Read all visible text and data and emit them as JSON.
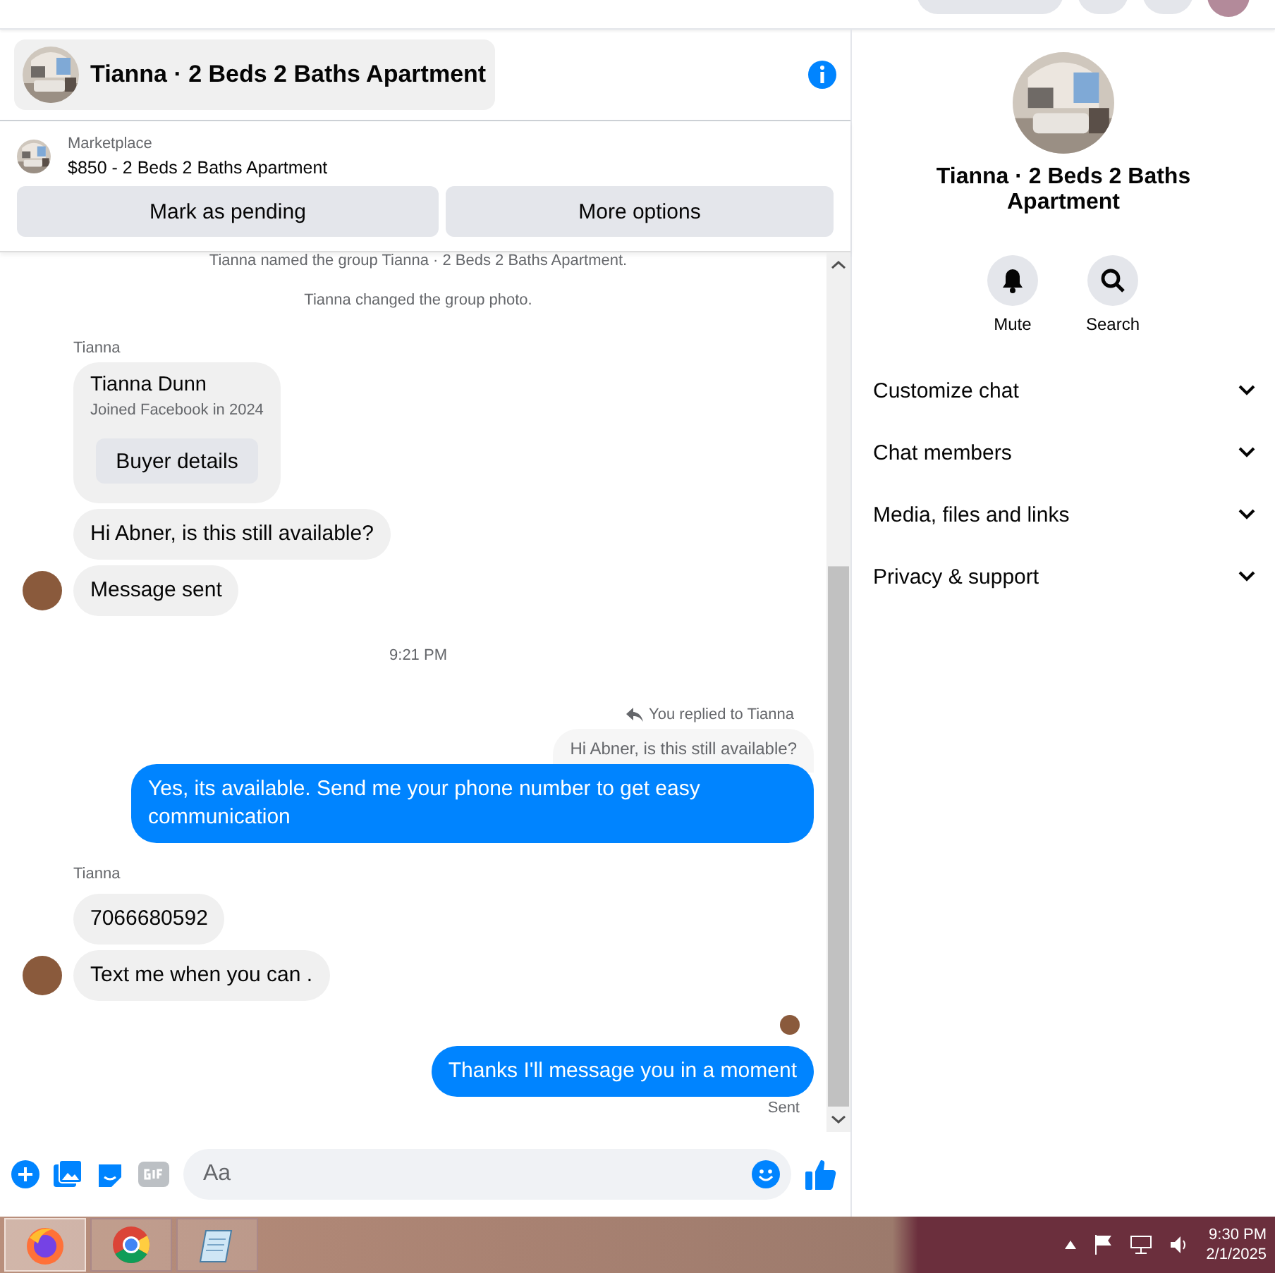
{
  "conversation_header": {
    "title": "Tianna · 2 Beds 2 Baths Apartment"
  },
  "listing": {
    "source": "Marketplace",
    "title": "$850 - 2 Beds 2 Baths Apartment",
    "actions": [
      "Mark as pending",
      "More options"
    ]
  },
  "messages": [
    {
      "kind": "system",
      "text": "Tianna named the group Tianna · 2 Beds 2 Baths Apartment."
    },
    {
      "kind": "system",
      "text": "Tianna changed the group photo."
    },
    {
      "kind": "sender",
      "text": "Tianna"
    },
    {
      "kind": "card",
      "name": "Tianna Dunn",
      "subtitle": "Joined Facebook in 2024",
      "button": "Buyer details"
    },
    {
      "kind": "incoming",
      "text": "Hi Abner, is this still available?",
      "avatar": false
    },
    {
      "kind": "incoming",
      "text": "Message sent",
      "avatar": true
    },
    {
      "kind": "time",
      "text": "9:21 PM"
    },
    {
      "kind": "reply_note",
      "text": "You replied to Tianna"
    },
    {
      "kind": "quote",
      "text": "Hi Abner, is this still available?"
    },
    {
      "kind": "outgoing",
      "text": "Yes, its available. Send me your phone number to get easy communication"
    },
    {
      "kind": "sender",
      "text": "Tianna"
    },
    {
      "kind": "incoming",
      "text": "7066680592",
      "avatar": false
    },
    {
      "kind": "incoming",
      "text": "Text me when you can .",
      "avatar": true
    },
    {
      "kind": "seen"
    },
    {
      "kind": "outgoing",
      "text": "Thanks I'll message you in a moment"
    },
    {
      "kind": "status",
      "text": "Sent"
    }
  ],
  "composer": {
    "placeholder": "Aa"
  },
  "details": {
    "title": "Tianna · 2 Beds 2 Baths Apartment",
    "actions": [
      {
        "kind": "mute",
        "label": "Mute"
      },
      {
        "kind": "search",
        "label": "Search"
      }
    ],
    "sections": [
      {
        "label": "Customize chat",
        "expanded": false
      },
      {
        "label": "Chat members",
        "expanded": false
      },
      {
        "label": "Media, files and links",
        "expanded": false
      },
      {
        "label": "Privacy & support",
        "expanded": false
      }
    ]
  },
  "taskbar": {
    "apps": [
      {
        "kind": "firefox",
        "selected": true
      },
      {
        "kind": "chrome",
        "selected": false
      },
      {
        "kind": "notepad",
        "selected": false
      }
    ],
    "time": "9:30 PM",
    "date": "2/1/2025"
  }
}
